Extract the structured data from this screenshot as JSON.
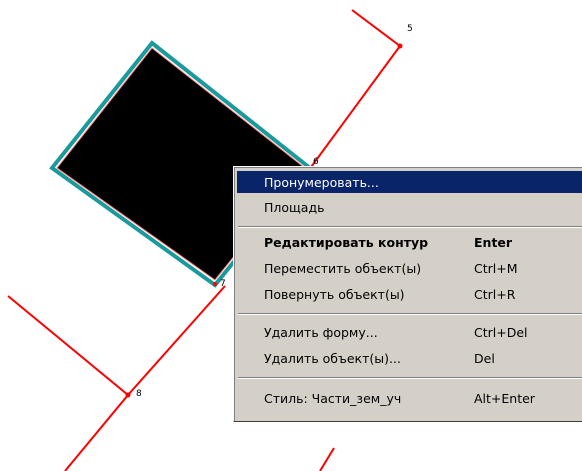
{
  "vertex_labels": [
    "5",
    "6",
    "7",
    "8"
  ],
  "menu": {
    "items": [
      {
        "label": "Пронумеровать...",
        "shortcut": "",
        "highlighted": true,
        "bold": false
      },
      {
        "label": "Площадь",
        "shortcut": "",
        "highlighted": false,
        "bold": false
      },
      {
        "label": "Редактировать контур",
        "shortcut": "Enter",
        "highlighted": false,
        "bold": true
      },
      {
        "label": "Переместить объект(ы)",
        "shortcut": "Ctrl+M",
        "highlighted": false,
        "bold": false
      },
      {
        "label": "Повернуть объект(ы)",
        "shortcut": "Ctrl+R",
        "highlighted": false,
        "bold": false
      },
      {
        "label": "Удалить форму...",
        "shortcut": "Ctrl+Del",
        "highlighted": false,
        "bold": false
      },
      {
        "label": "Удалить объект(ы)...",
        "shortcut": "Del",
        "highlighted": false,
        "bold": false
      },
      {
        "label": "Стиль: Части_зем_уч",
        "shortcut": "Alt+Enter",
        "highlighted": false,
        "bold": false
      }
    ]
  },
  "colors": {
    "boundary_line": "#ff0000",
    "shape_fill": "#000000",
    "shape_outline": "#1a9a9a",
    "menu_highlight": "#0a246a",
    "menu_background": "#d4d0c8"
  }
}
